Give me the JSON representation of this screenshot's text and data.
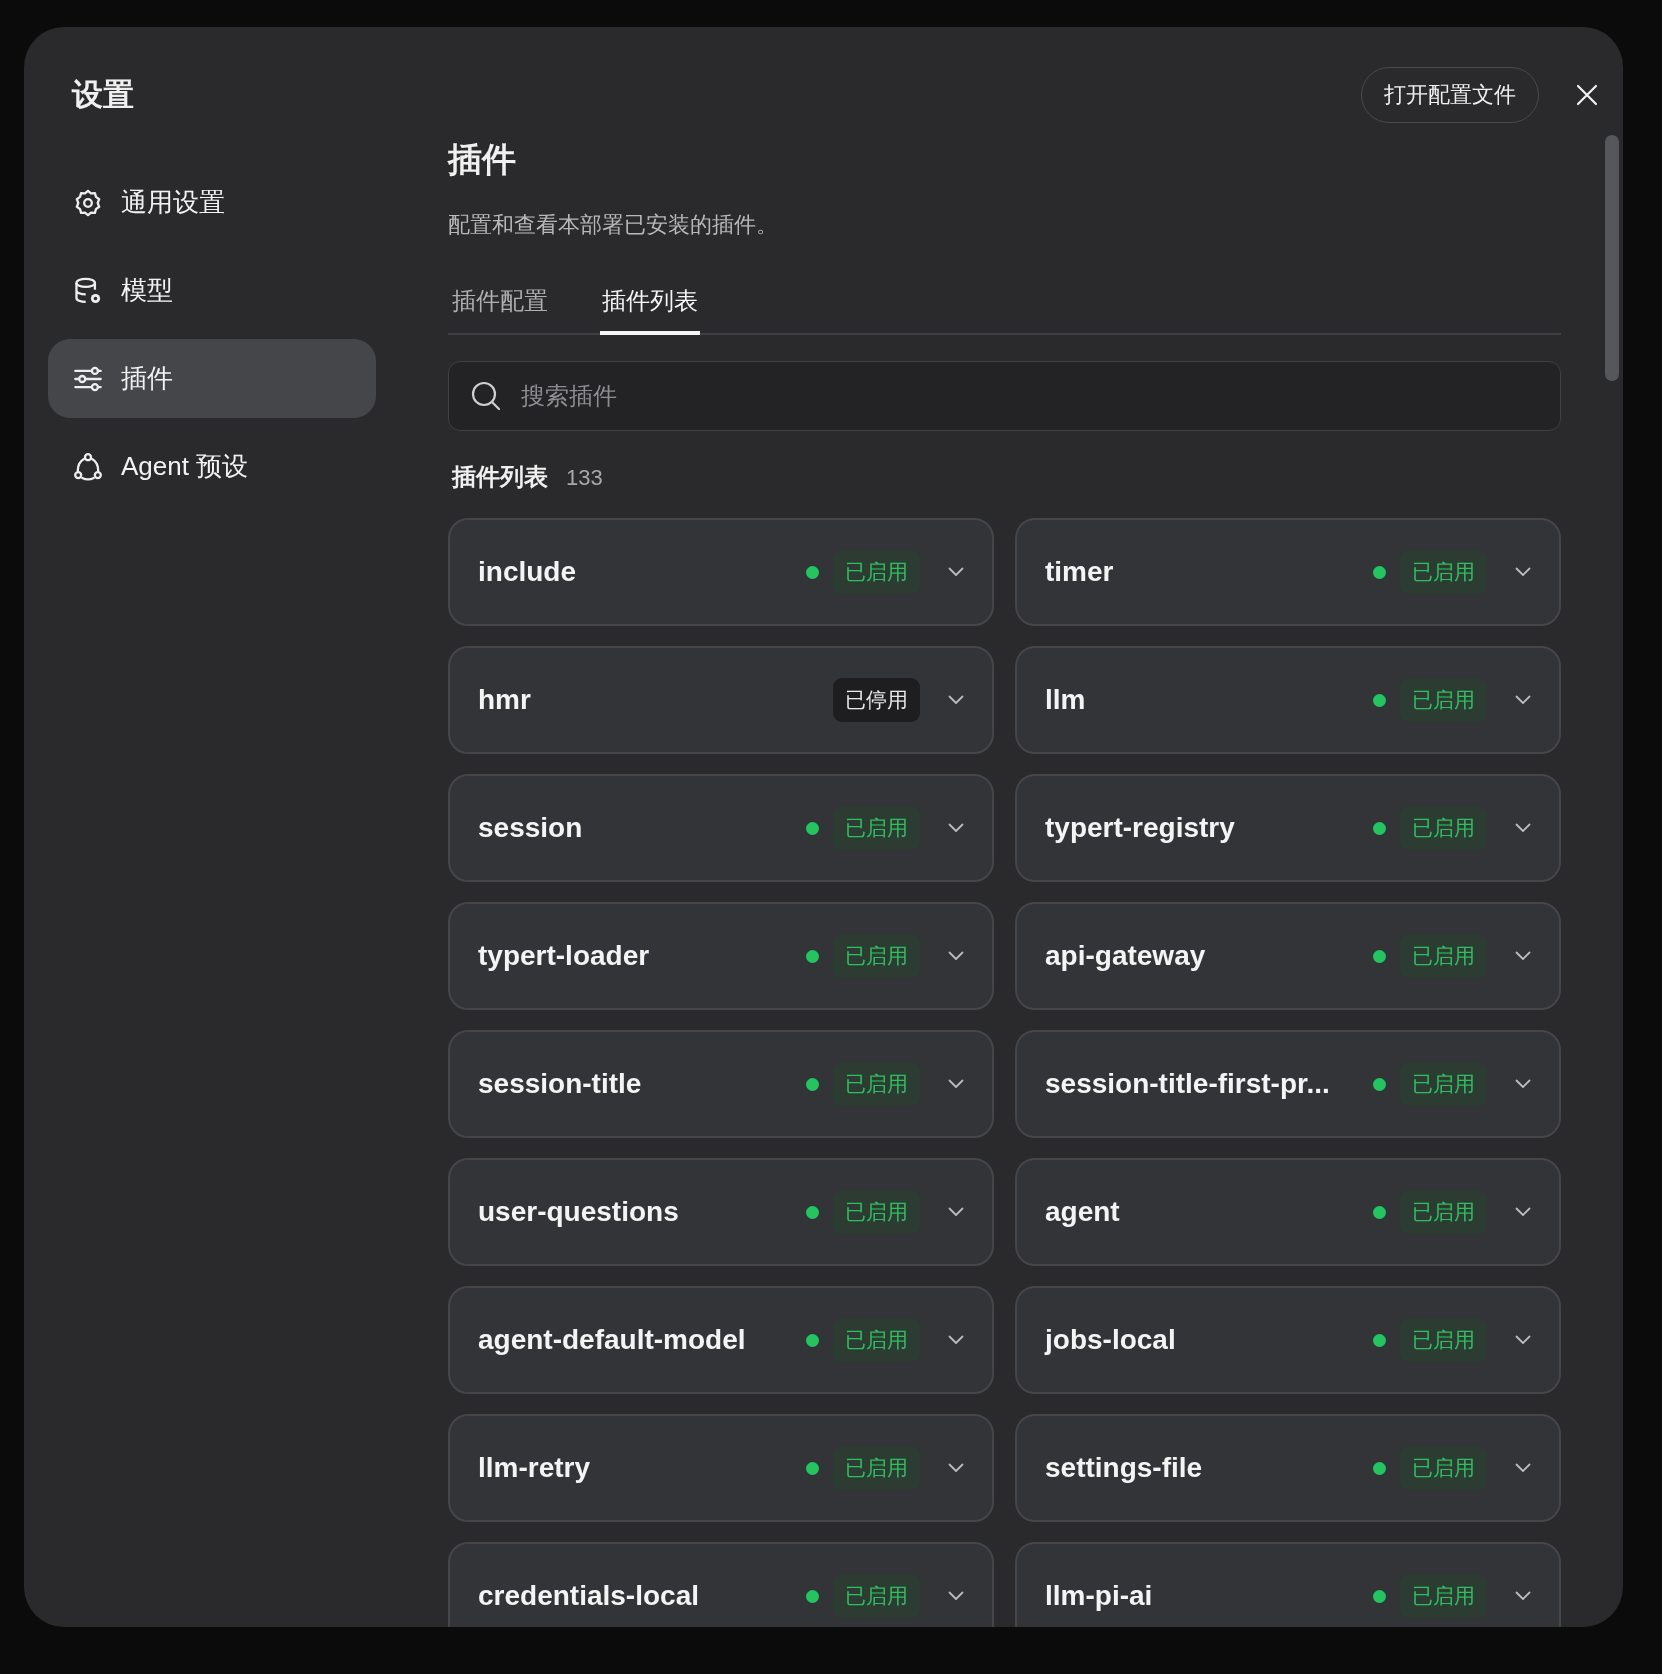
{
  "dialog": {
    "title": "设置",
    "open_config_button": "打开配置文件"
  },
  "sidebar": {
    "items": [
      {
        "label": "通用设置",
        "selected": false
      },
      {
        "label": "模型",
        "selected": false
      },
      {
        "label": "插件",
        "selected": true
      },
      {
        "label": "Agent 预设",
        "selected": false
      }
    ]
  },
  "page": {
    "title": "插件",
    "description": "配置和查看本部署已安装的插件。"
  },
  "tabs": [
    {
      "label": "插件配置",
      "selected": false
    },
    {
      "label": "插件列表",
      "selected": true
    }
  ],
  "search": {
    "placeholder": "搜索插件"
  },
  "plugin_list": {
    "heading": "插件列表",
    "count": "133",
    "plugins": [
      {
        "name": "include",
        "enabled": true,
        "status": "已启用"
      },
      {
        "name": "timer",
        "enabled": true,
        "status": "已启用"
      },
      {
        "name": "hmr",
        "enabled": false,
        "status": "已停用"
      },
      {
        "name": "llm",
        "enabled": true,
        "status": "已启用"
      },
      {
        "name": "session",
        "enabled": true,
        "status": "已启用"
      },
      {
        "name": "typert-registry",
        "enabled": true,
        "status": "已启用"
      },
      {
        "name": "typert-loader",
        "enabled": true,
        "status": "已启用"
      },
      {
        "name": "api-gateway",
        "enabled": true,
        "status": "已启用"
      },
      {
        "name": "session-title",
        "enabled": true,
        "status": "已启用"
      },
      {
        "name": "session-title-first-pr...",
        "enabled": true,
        "status": "已启用"
      },
      {
        "name": "user-questions",
        "enabled": true,
        "status": "已启用"
      },
      {
        "name": "agent",
        "enabled": true,
        "status": "已启用"
      },
      {
        "name": "agent-default-model",
        "enabled": true,
        "status": "已启用"
      },
      {
        "name": "jobs-local",
        "enabled": true,
        "status": "已启用"
      },
      {
        "name": "llm-retry",
        "enabled": true,
        "status": "已启用"
      },
      {
        "name": "settings-file",
        "enabled": true,
        "status": "已启用"
      },
      {
        "name": "credentials-local",
        "enabled": true,
        "status": "已启用"
      },
      {
        "name": "llm-pi-ai",
        "enabled": true,
        "status": "已启用"
      }
    ]
  }
}
